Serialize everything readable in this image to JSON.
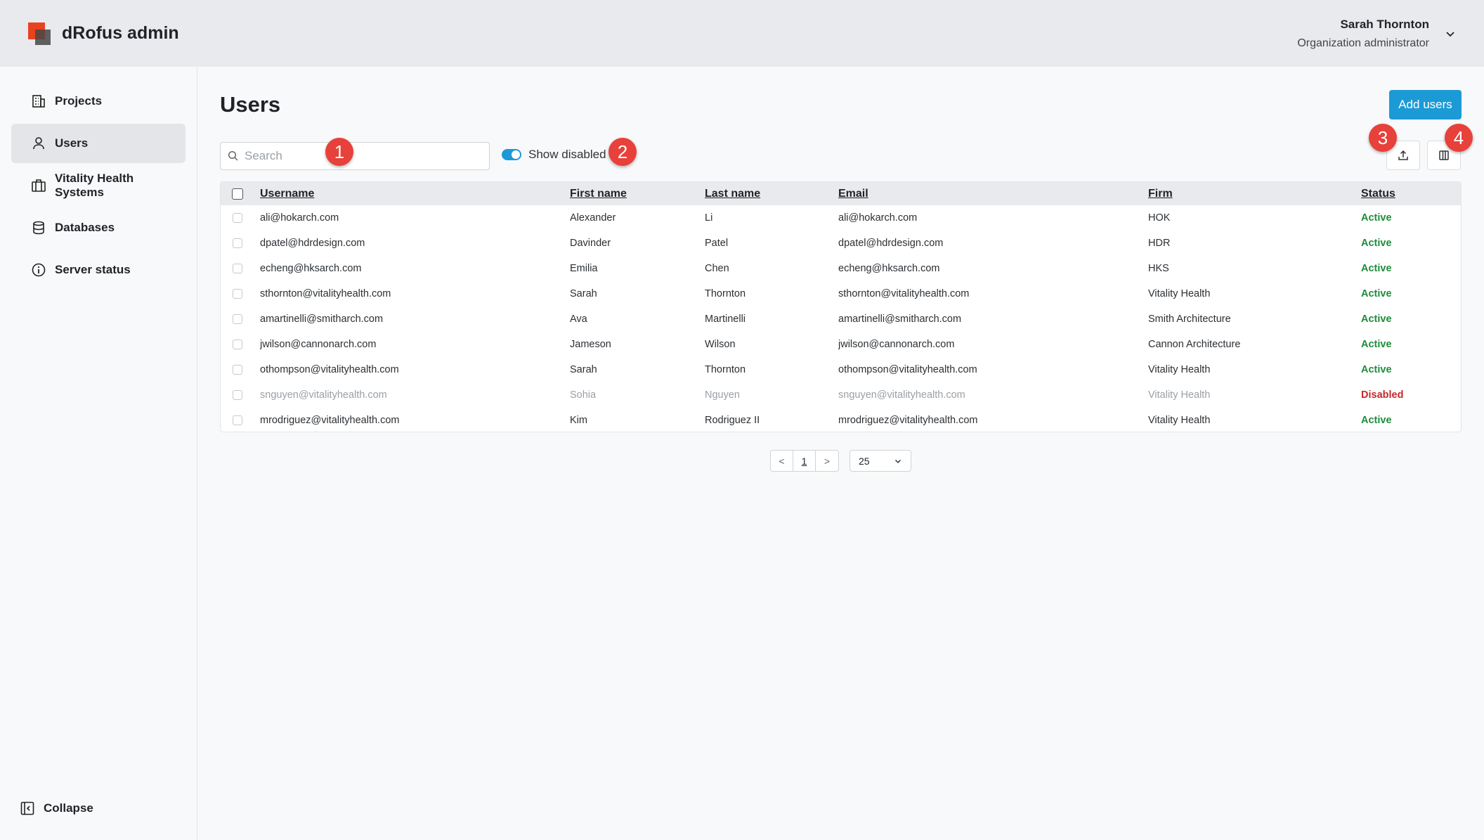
{
  "app": {
    "title": "dRofus admin"
  },
  "user": {
    "name": "Sarah Thornton",
    "role": "Organization administrator"
  },
  "sidebar": {
    "items": [
      {
        "label": "Projects",
        "icon": "building-icon"
      },
      {
        "label": "Users",
        "icon": "user-icon",
        "active": true
      },
      {
        "label": "Vitality Health Systems",
        "icon": "briefcase-icon"
      },
      {
        "label": "Databases",
        "icon": "database-icon"
      },
      {
        "label": "Server status",
        "icon": "info-icon"
      }
    ],
    "collapse_label": "Collapse"
  },
  "page": {
    "title": "Users",
    "add_button": "Add users"
  },
  "search": {
    "placeholder": "Search",
    "value": ""
  },
  "toggle": {
    "label": "Show disabled",
    "on": true
  },
  "toolbar": {
    "export_icon": "upload-icon",
    "columns_icon": "columns-icon"
  },
  "badges": [
    "1",
    "2",
    "3",
    "4"
  ],
  "colors": {
    "accent": "#1c9ad6",
    "active": "#1e8c3a",
    "disabled": "#c62828",
    "badge": "#e8403a",
    "logo": "#e8431f"
  },
  "table": {
    "columns": [
      "Username",
      "First name",
      "Last name",
      "Email",
      "Firm",
      "Status"
    ],
    "rows": [
      {
        "username": "ali@hokarch.com",
        "first": "Alexander",
        "last": "Li",
        "email": "ali@hokarch.com",
        "firm": "HOK",
        "status": "Active"
      },
      {
        "username": "dpatel@hdrdesign.com",
        "first": "Davinder",
        "last": "Patel",
        "email": "dpatel@hdrdesign.com",
        "firm": "HDR",
        "status": "Active"
      },
      {
        "username": "echeng@hksarch.com",
        "first": "Emilia",
        "last": "Chen",
        "email": "echeng@hksarch.com",
        "firm": "HKS",
        "status": "Active"
      },
      {
        "username": "sthornton@vitalityhealth.com",
        "first": "Sarah",
        "last": "Thornton",
        "email": "sthornton@vitalityhealth.com",
        "firm": "Vitality Health",
        "status": "Active"
      },
      {
        "username": "amartinelli@smitharch.com",
        "first": "Ava",
        "last": "Martinelli",
        "email": "amartinelli@smitharch.com",
        "firm": "Smith Architecture",
        "status": "Active"
      },
      {
        "username": "jwilson@cannonarch.com",
        "first": "Jameson",
        "last": "Wilson",
        "email": "jwilson@cannonarch.com",
        "firm": "Cannon Architecture",
        "status": "Active"
      },
      {
        "username": "othompson@vitalityhealth.com",
        "first": "Sarah",
        "last": "Thornton",
        "email": "othompson@vitalityhealth.com",
        "firm": "Vitality Health",
        "status": "Active"
      },
      {
        "username": "snguyen@vitalityhealth.com",
        "first": "Sohia",
        "last": "Nguyen",
        "email": "snguyen@vitalityhealth.com",
        "firm": "Vitality Health",
        "status": "Disabled"
      },
      {
        "username": "mrodriguez@vitalityhealth.com",
        "first": "Kim",
        "last": "Rodriguez II",
        "email": "mrodriguez@vitalityhealth.com",
        "firm": "Vitality Health",
        "status": "Active"
      }
    ]
  },
  "pagination": {
    "prev": "<",
    "current": "1",
    "next": ">",
    "page_size": "25"
  }
}
